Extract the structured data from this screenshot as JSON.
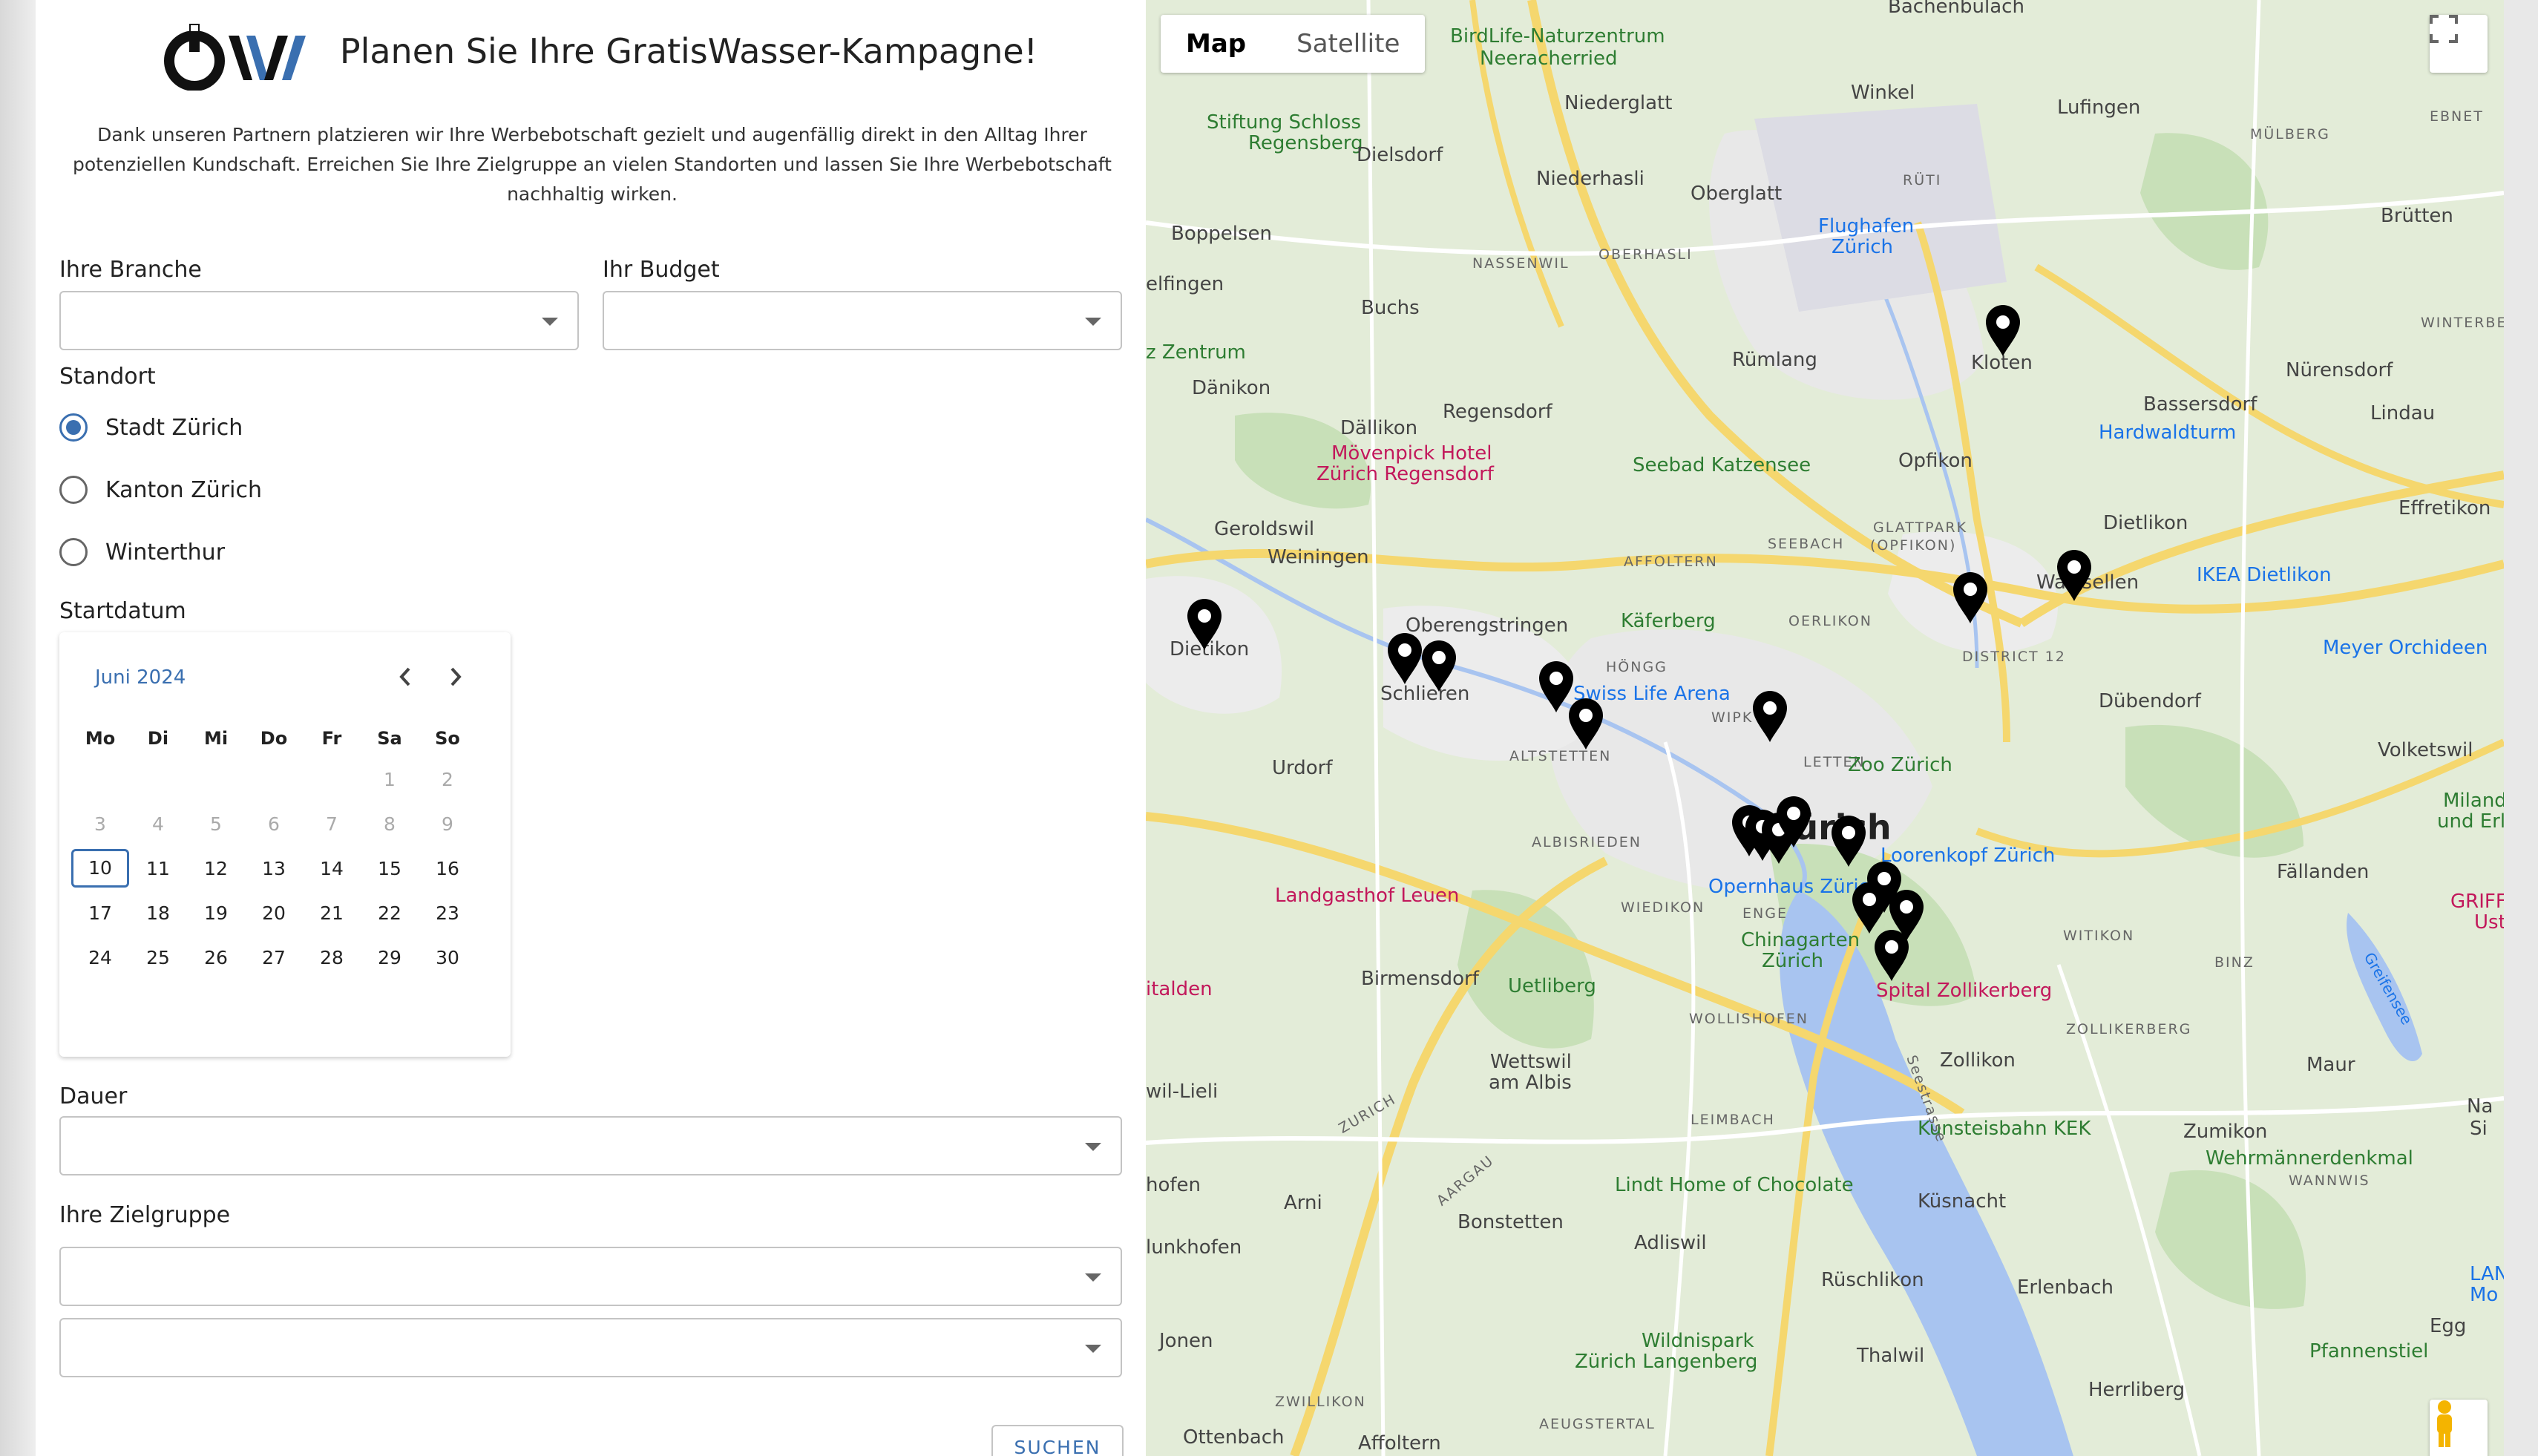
{
  "header": {
    "title": "Planen Sie Ihre GratisWasser-Kampagne!",
    "intro_line1": "Dank unseren Partnern platzieren wir Ihre Werbebotschaft gezielt und augenfällig direkt in den Alltag Ihrer",
    "intro_line2": "potenziellen Kundschaft. Erreichen Sie Ihre Zielgruppe an vielen Standorten und lassen Sie Ihre Werbebotschaft",
    "intro_line3": "nachhaltig wirken."
  },
  "form": {
    "branche_label": "Ihre Branche",
    "budget_label": "Ihr Budget",
    "standort_label": "Standort",
    "standort_options": [
      "Stadt Zürich",
      "Kanton Zürich",
      "Winterthur"
    ],
    "standort_selected": "Stadt Zürich",
    "startdatum_label": "Startdatum",
    "dauer_label": "Dauer",
    "zielgruppe_label": "Ihre Zielgruppe",
    "search_label": "SUCHEN"
  },
  "calendar": {
    "month": "Juni 2024",
    "weekdays": [
      "Mo",
      "Di",
      "Mi",
      "Do",
      "Fr",
      "Sa",
      "So"
    ],
    "weeks": [
      [
        "",
        "",
        "",
        "",
        "",
        "1",
        "2"
      ],
      [
        "3",
        "4",
        "5",
        "6",
        "7",
        "8",
        "9"
      ],
      [
        "10",
        "11",
        "12",
        "13",
        "14",
        "15",
        "16"
      ],
      [
        "17",
        "18",
        "19",
        "20",
        "21",
        "22",
        "23"
      ],
      [
        "24",
        "25",
        "26",
        "27",
        "28",
        "29",
        "30"
      ]
    ],
    "selected_day": "10",
    "first_enabled_day": 10
  },
  "map": {
    "type_map": "Map",
    "type_satellite": "Satellite",
    "places": {
      "bachenbulach": "Bachenbülach",
      "birdlife": "BirdLife-Naturzentrum",
      "neeracherried": "Neeracherried",
      "winkel": "Winkel",
      "niederglatt": "Niederglatt",
      "lufingen": "Lufingen",
      "stiftung1": "Stiftung Schloss",
      "stiftung2": "Regensberg",
      "dielsdorf": "Dielsdorf",
      "niederhasli": "Niederhasli",
      "oberglatt": "Oberglatt",
      "flughafen1": "Flughafen",
      "flughafen2": "Zürich",
      "mulberg": "MÜLBERG",
      "ebnet": "EBNET",
      "brutten": "Brütten",
      "boppelsen": "Boppelsen",
      "nassenwil": "NASSENWIL",
      "oberhasli": "OBERHASLI",
      "rutu": "RÜTI",
      "ifingen": "elfingen",
      "buchs": "Buchs",
      "zentrum": "z Zentrum",
      "danikon": "Dänikon",
      "rumlang": "Rümlang",
      "kloten": "Kloten",
      "nurensdorf": "Nürensdorf",
      "winterberg": "WINTERBERG",
      "bassersdorf": "Bassersdorf",
      "lindau": "Lindau",
      "dallikon": "Dällikon",
      "regensdorf": "Regensdorf",
      "hardwald": "Hardwaldturm",
      "movenpick1": "Mövenpick Hotel",
      "movenpick2": "Zürich Regensdorf",
      "katzensee": "Seebad Katzensee",
      "opfikon": "Opfikon",
      "geroldswil": "Geroldswil",
      "seebach": "SEEBACH",
      "glattpark1": "GLATTPARK",
      "glattpark2": "(OPFIKON)",
      "dietlikon": "Dietlikon",
      "effretikon": "Effretikon",
      "weiningen": "Weiningen",
      "affoltern": "AFFOLTERN",
      "ikea": "IKEA Dietlikon",
      "wallisellen": "Wallisellen",
      "oberengstringen": "Oberengstringen",
      "kaferberg": "Käferberg",
      "oerlikon": "OERLIKON",
      "district12": "DISTRICT 12",
      "dietikon": "Dietikon",
      "meyer": "Meyer Orchideen",
      "hongg": "HÖNGG",
      "schlieren": "Schlieren",
      "swisslife": "Swiss Life Arena",
      "dubendorf": "Dübendorf",
      "wipk": "WIPK",
      "volketswil": "Volketswil",
      "altstetten": "ALTSTETTEN",
      "letten": "LETTEN",
      "zoo": "Zoo Zürich",
      "urdorf": "Urdorf",
      "zurich": "Zürich",
      "milandia1": "Milandia",
      "milandia2": "und Erlebr",
      "albisrieden": "ALBISRIEDEN",
      "lorenkopf": "Loorenkopf Zürich",
      "opernhaus": "Opernhaus Zürich",
      "fallanden": "Fällanden",
      "griffig1": "GRIFFIG",
      "griffig2": "Ust",
      "landgasthof": "Landgasthof Leuen",
      "wiedikon": "WIEDIKON",
      "enge": "ENGE",
      "witikon": "WITIKON",
      "chinagarten1": "Chinagarten",
      "chinagarten2": "Zürich",
      "binz": "BINZ",
      "birmensdorf": "Birmensdorf",
      "uetliberg": "Uetliberg",
      "spital": "Spital Zollikerberg",
      "zollikerberg": "ZOLLIKERBERG",
      "italden": "italden",
      "wettswil1": "Wettswil",
      "wettswil2": "am Albis",
      "wollishofen": "WOLLISHOFEN",
      "zollikon": "Zollikon",
      "maur": "Maur",
      "wilieli": "wil-Lieli",
      "zurich_sign": "ZURICH",
      "kunsteisbahn": "Kunsteisbahn KEK",
      "zumikon": "Zumikon",
      "leimbach": "LEIMBACH",
      "wehrmann": "Wehrmännerdenkmal",
      "wannwis": "WANNWIS",
      "aargau": "AARGAU",
      "nasi": "Na",
      "si": "Si",
      "hofen": "hofen",
      "arni": "Arni",
      "bonstetten": "Bonstetten",
      "lindt": "Lindt Home of Chocolate",
      "kusnacht": "Küsnacht",
      "adliswil": "Adliswil",
      "lan": "LAN",
      "mo": "Mo",
      "unkhofen": "lunkhofen",
      "ruschlikon": "Rüschlikon",
      "erlenbach": "Erlenbach",
      "jonen": "Jonen",
      "wildnispark1": "Wildnispark",
      "wildnispark2": "Zürich Langenberg",
      "thalwil": "Thalwil",
      "pfannenstiel": "Pfannenstiel",
      "egg": "Egg",
      "zwillikon": "ZWILLIKON",
      "herrliberg": "Herrliberg",
      "ottenbach": "Ottenbach",
      "affoltern2": "Affoltern",
      "augstertal": "AEUGSTERTAL",
      "greifensee": "Greifensee",
      "seestrasse": "Seestrasse"
    },
    "marker_count": 18
  },
  "colors": {
    "accent": "#3a6fb0",
    "water": "#a8c4f0",
    "green": "#cfe5c2",
    "road_yellow": "#f5d76e",
    "marker": "#000000"
  }
}
